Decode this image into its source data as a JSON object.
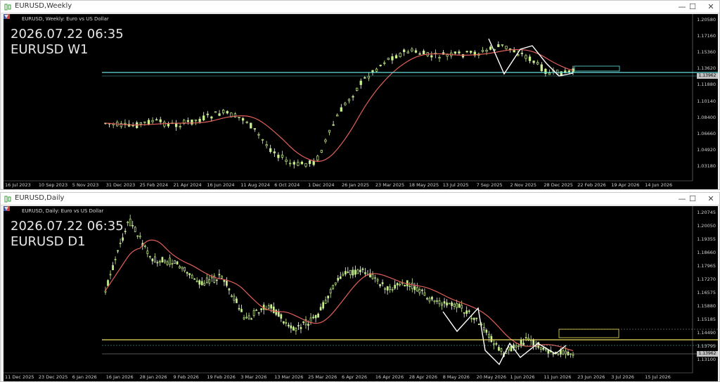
{
  "windows": [
    {
      "title": "EURUSD,Weekly",
      "header": "EURUSD, Weekly: Euro vs US Dollar",
      "clock": "2026.07.22 06:35",
      "symbol_tf": "EURUSD W1",
      "price_label": "1.13962",
      "y_labels": [
        "1.20580",
        "1.17160",
        "1.15360",
        "1.13620",
        "1.11880",
        "1.10140",
        "1.08400",
        "1.06660",
        "1.04920",
        "1.03180"
      ],
      "x_labels": [
        "16 Jul 2023",
        "10 Sep 2023",
        "5 Nov 2023",
        "31 Dec 2023",
        "25 Feb 2024",
        "21 Apr 2024",
        "16 Jun 2024",
        "11 Aug 2024",
        "6 Oct 2024",
        "1 Dec 2024",
        "26 Jan 2025",
        "23 Mar 2025",
        "18 May 2025",
        "13 Jul 2025",
        "7 Sep 2025",
        "2 Nov 2025",
        "28 Dec 2025",
        "22 Feb 2026",
        "19 Apr 2026",
        "14 Jun 2026"
      ]
    },
    {
      "title": "EURUSD,Daily",
      "header": "EURUSD, Daily: Euro vs US Dollar",
      "clock": "2026.07.22 06:35",
      "symbol_tf": "EURUSD D1",
      "price_label": "1.13962",
      "y_labels": [
        "1.20745",
        "1.20050",
        "1.19355",
        "1.18660",
        "1.17965",
        "1.17270",
        "1.16575",
        "1.15880",
        "1.15185",
        "1.14490",
        "1.13795",
        "1.13100"
      ],
      "x_labels": [
        "11 Dec 2025",
        "23 Dec 2025",
        "6 Jan 2026",
        "16 Jan 2026",
        "28 Jan 2026",
        "9 Feb 2026",
        "19 Feb 2026",
        "3 Mar 2026",
        "13 Mar 2026",
        "25 Mar 2026",
        "6 Apr 2026",
        "16 Apr 2026",
        "28 Apr 2026",
        "8 May 2026",
        "20 May 2026",
        "1 Jun 2026",
        "11 Jun 2026",
        "23 Jun 2026",
        "3 Jul 2026",
        "15 Jul 2026"
      ]
    }
  ],
  "icons": {
    "window": "candlestick-window-icon",
    "flag": "eu-us-flag-icon",
    "arrow": "one-click-arrow-icon"
  },
  "buttons": {
    "minimize": "—",
    "maximize": "☐",
    "close": "✕"
  },
  "colors": {
    "bull": "#c8f08c",
    "bear": "#ffffff",
    "ma": "#e0605a",
    "cyan": "#66e0e0",
    "yellow": "#f0e060",
    "zigzag": "#ffffff"
  }
}
